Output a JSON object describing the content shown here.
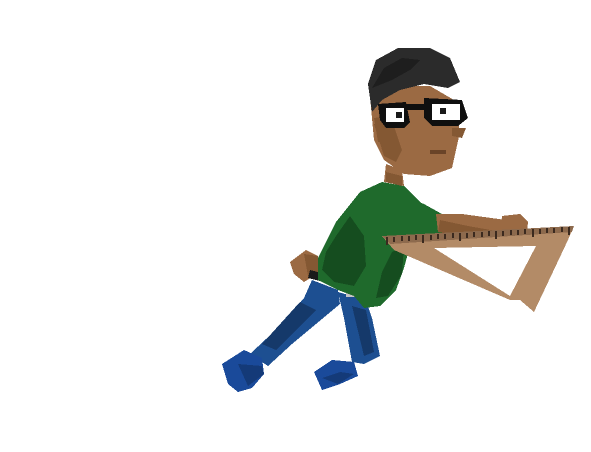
{
  "scene": {
    "background_color": "#ffffff",
    "character": {
      "icon": "pixel-art-student-sprite",
      "pose": "lunging-forward",
      "colors": {
        "hair": "#2b2b2b",
        "skin": "#9b6a43",
        "skin_shadow": "#845833",
        "glasses": "#0f0f0f",
        "shirt": "#1f6a2c",
        "shirt_shadow": "#154d1f",
        "jeans": "#1d4f91",
        "jeans_shadow": "#15396a",
        "shoes": "#1a4a9a",
        "belt": "#1a1a1a"
      }
    },
    "held_item": {
      "icon": "wooden-triangle-ruler",
      "colors": {
        "wood": "#b38b67",
        "wood_shadow": "#8d6a4d",
        "ticks": "#3b2a1f"
      }
    }
  }
}
